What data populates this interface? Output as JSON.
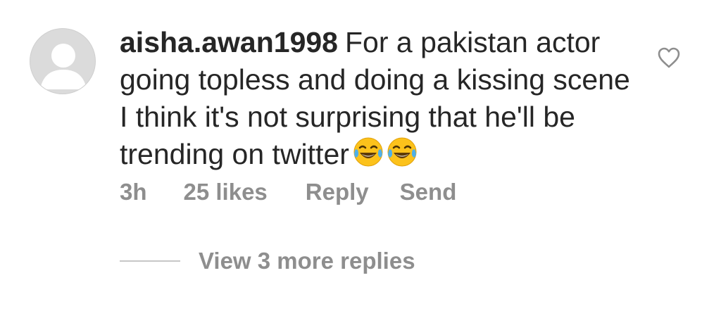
{
  "comment": {
    "username": "aisha.awan1998",
    "text": "For a pakistan actor going topless and doing a kissing scene I think it's not surprising that he'll be trending on twitter",
    "emojis": [
      "face-with-tears-of-joy",
      "face-with-tears-of-joy"
    ],
    "avatar_icon": "default-avatar-icon",
    "like_icon": "heart-outline-icon"
  },
  "meta": {
    "time": "3h",
    "likes": "25 likes",
    "reply": "Reply",
    "send": "Send"
  },
  "replies": {
    "label": "View 3 more replies"
  },
  "colors": {
    "text": "#262626",
    "secondary": "#8e8e8e",
    "avatar_bg": "#dbdbdb",
    "divider": "#c7c7c7"
  }
}
